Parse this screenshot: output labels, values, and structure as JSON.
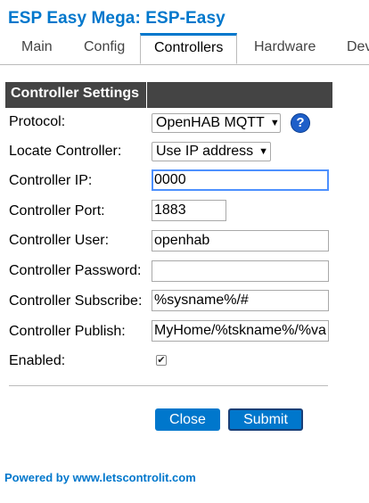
{
  "app": {
    "title": "ESP Easy Mega: ESP-Easy"
  },
  "tabs": [
    {
      "label": "Main"
    },
    {
      "label": "Config"
    },
    {
      "label": "Controllers"
    },
    {
      "label": "Hardware"
    },
    {
      "label": "Dev"
    }
  ],
  "active_tab": "Controllers",
  "section": {
    "title": "Controller Settings"
  },
  "form": {
    "protocol": {
      "label": "Protocol:",
      "value": "OpenHAB MQTT"
    },
    "locate": {
      "label": "Locate Controller:",
      "value": "Use IP address"
    },
    "ip": {
      "label": "Controller IP:",
      "value": "0000"
    },
    "port": {
      "label": "Controller Port:",
      "value": "1883"
    },
    "user": {
      "label": "Controller User:",
      "value": "openhab"
    },
    "password": {
      "label": "Controller Password:",
      "value": ""
    },
    "subscribe": {
      "label": "Controller Subscribe:",
      "value": "%sysname%/#"
    },
    "publish": {
      "label": "Controller Publish:",
      "value": "MyHome/%tskname%/%val"
    },
    "enabled": {
      "label": "Enabled:",
      "checked": true
    }
  },
  "icons": {
    "help": "help-icon",
    "dropdown": "chevron-down-icon",
    "check": "check-icon"
  },
  "help_glyph": "?",
  "buttons": {
    "close": "Close",
    "submit": "Submit"
  },
  "footer": {
    "text": "Powered by www.letscontrolit.com"
  },
  "colors": {
    "accent": "#0077cc",
    "header_bg": "#444444",
    "help_bg": "#1e5fc9"
  }
}
